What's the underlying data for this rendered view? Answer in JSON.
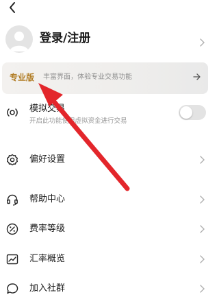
{
  "header": {
    "back_icon": "back-arrow-icon"
  },
  "profile": {
    "login_label": "登录/注册",
    "avatar_icon": "default-avatar-icon"
  },
  "pro_banner": {
    "tag": "专业版",
    "description": "丰富界面，体验专业交易功能",
    "accent": "#b07b22"
  },
  "settings": {
    "simulated_trading": {
      "label": "模拟交易",
      "sublabel": "开启此功能使用虚拟资金进行交易",
      "toggle_on": false
    },
    "preferences": {
      "label": "偏好设置"
    },
    "help_center": {
      "label": "帮助中心"
    },
    "fee_level": {
      "label": "费率等级"
    },
    "exchange_rates": {
      "label": "汇率概览"
    },
    "join_community": {
      "label": "加入社群"
    }
  },
  "annotation": {
    "color": "#e3262b",
    "icon": "red-pointer-arrow"
  }
}
